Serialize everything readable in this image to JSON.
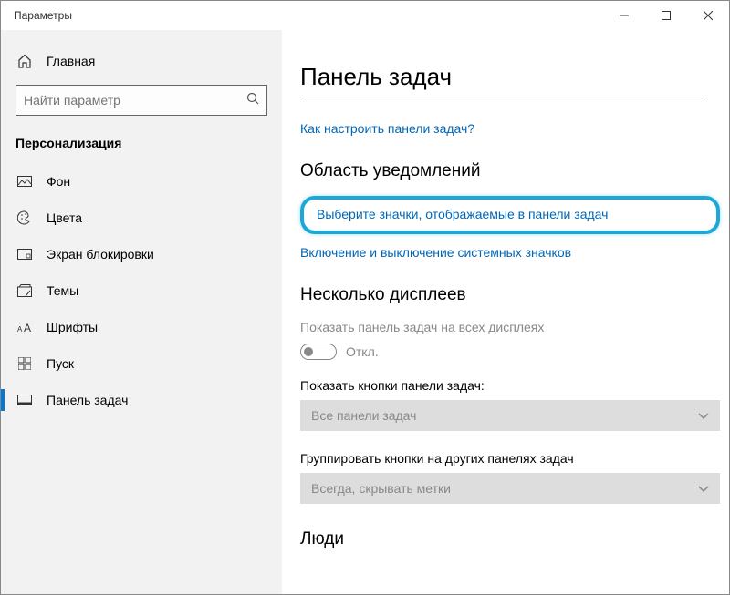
{
  "window": {
    "title": "Параметры"
  },
  "sidebar": {
    "home": "Главная",
    "search_placeholder": "Найти параметр",
    "category": "Персонализация",
    "items": [
      {
        "label": "Фон"
      },
      {
        "label": "Цвета"
      },
      {
        "label": "Экран блокировки"
      },
      {
        "label": "Темы"
      },
      {
        "label": "Шрифты"
      },
      {
        "label": "Пуск"
      },
      {
        "label": "Панель задач"
      }
    ]
  },
  "main": {
    "title": "Панель задач",
    "help_link": "Как настроить панели задач?",
    "section_notify": "Область уведомлений",
    "link_select_icons": "Выберите значки, отображаемые в панели задач",
    "link_system_icons": "Включение и выключение системных значков",
    "section_displays": "Несколько дисплеев",
    "show_taskbar_label": "Показать панель задач на всех дисплеях",
    "toggle_state": "Откл.",
    "buttons_label": "Показать кнопки панели задач:",
    "buttons_value": "Все панели задач",
    "group_label": "Группировать кнопки на других панелях задач",
    "group_value": "Всегда, скрывать метки",
    "section_people": "Люди"
  }
}
